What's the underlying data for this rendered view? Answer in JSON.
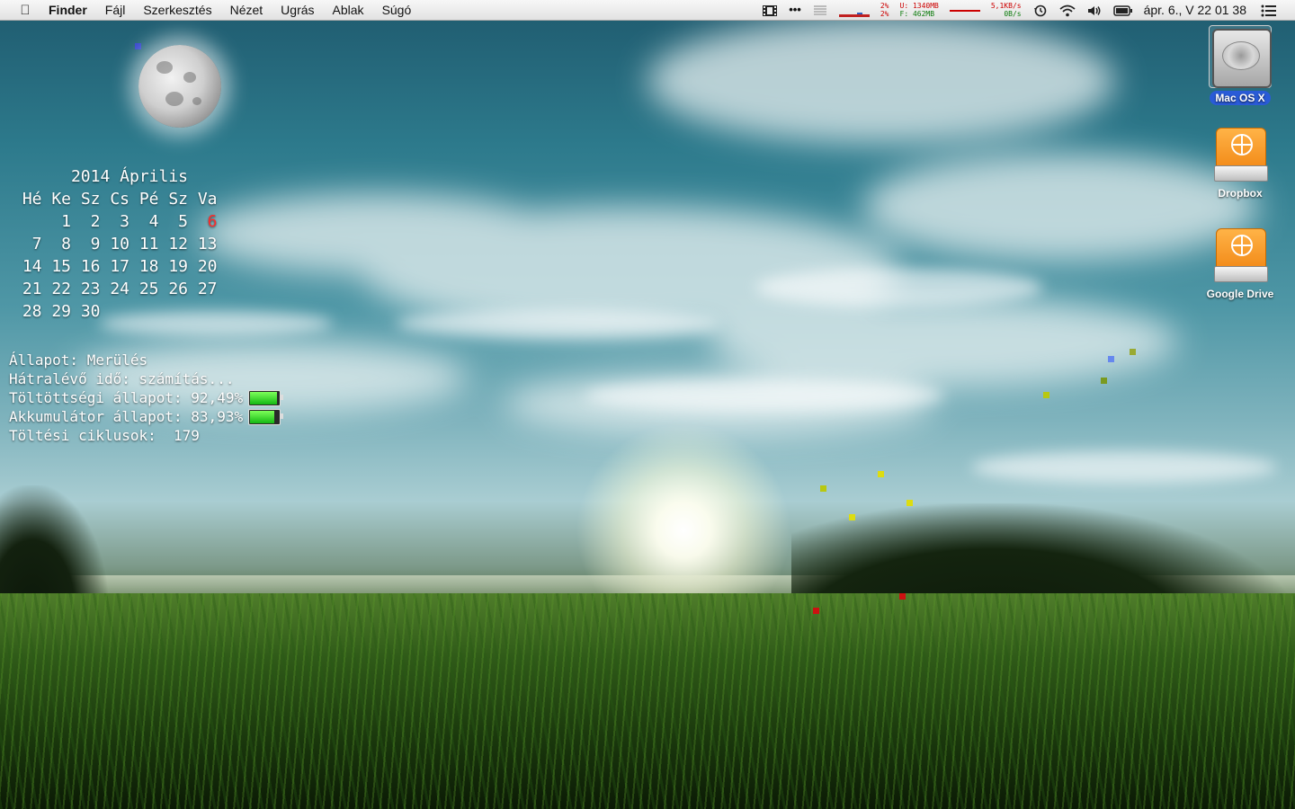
{
  "menubar": {
    "apple_icon": "apple-logo-icon",
    "app_name": "Finder",
    "items": [
      "Fájl",
      "Szerkesztés",
      "Nézet",
      "Ugrás",
      "Ablak",
      "Súgó"
    ]
  },
  "status": {
    "cpu_top": "2%",
    "cpu_bottom": "2%",
    "mem_used": "U: 1340MB",
    "mem_free": "F:  462MB",
    "net_up": "5,1KB/s",
    "net_down": "0B/s",
    "clock": "ápr. 6., V  22 01 38"
  },
  "calendar": {
    "title": "2014 Április",
    "weekdays": [
      "Hé",
      "Ke",
      "Sz",
      "Cs",
      "Pé",
      "Sz",
      "Va"
    ],
    "weeks": [
      [
        "",
        "1",
        "2",
        "3",
        "4",
        "5",
        "6"
      ],
      [
        "7",
        "8",
        "9",
        "10",
        "11",
        "12",
        "13"
      ],
      [
        "14",
        "15",
        "16",
        "17",
        "18",
        "19",
        "20"
      ],
      [
        "21",
        "22",
        "23",
        "24",
        "25",
        "26",
        "27"
      ],
      [
        "28",
        "29",
        "30",
        "",
        "",
        "",
        ""
      ]
    ],
    "today": "6"
  },
  "battery": {
    "status": "Állapot: Merülés",
    "remaining": "Hátralévő idő: számítás...",
    "charge": "Töltöttségi állapot: 92,49%",
    "charge_level": 0.9249,
    "health": "Akkumulátor állapot: 83,93%",
    "health_level": 0.8393,
    "cycles": "Töltési ciklusok:  179"
  },
  "desktop_icons": [
    {
      "label": "Mac OS X",
      "icon": "hard-drive-icon",
      "selected": true
    },
    {
      "label": "Dropbox",
      "icon": "external-drive-icon"
    },
    {
      "label": "Google Drive",
      "icon": "external-drive-icon"
    }
  ]
}
